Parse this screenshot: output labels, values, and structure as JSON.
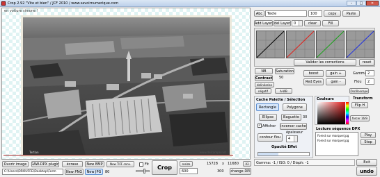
{
  "titlebar": {
    "title": "Crop 2.92  \"Vite et bien\"  / JCF 2010 / www.savoirnumerique.com"
  },
  "canvas": {
    "caption": "en voiture simone !"
  },
  "photo": {
    "credit_left": "Tertian",
    "credit_right": "www.delcampe.net"
  },
  "text_tool": {
    "abc_label": "Abc",
    "text_value": "Texte",
    "size_value": "100",
    "copy_label": "copy",
    "paste_label": "Paste"
  },
  "layers": {
    "add_label": "Add Layer",
    "del_label": "del Layer",
    "layer_value": "0",
    "clear_label": "clear",
    "fill_label": "Fill"
  },
  "curves": {
    "validate_label": "Valider les corrections",
    "reset_label": "reset"
  },
  "adjust": {
    "nb_label": "NB",
    "saturation_label": "Saturation",
    "contrast_label": "Contrast",
    "contrast_value": "50",
    "delinear_label": "delinéarise",
    "negatif_label": "négatif",
    "awb_label": "A-WB",
    "boost_label": "boost",
    "gain_plus_label": "gain +",
    "gamma_label": "Gamma",
    "gamma_value": "2",
    "red_eyes_label": "Red Eyes",
    "gain_minus_label": "gain -",
    "flou_label": "Flou",
    "flou_value": "2",
    "oscilloscope_label": "Oscilloscope"
  },
  "cache": {
    "title": "Cache Palette / Sélection",
    "rectangle_label": "Rectangle",
    "polygone_label": "Polygone",
    "ellipse_label": "Ellipse",
    "baguette_label": "Baguette",
    "baguette_value": "30",
    "afficher_label": "Afficher",
    "inverser_label": "inverser cache",
    "contour_label": "contour flou",
    "epaisseur_label": "épaisseur",
    "epaisseur_value": "4",
    "opacite_label": "Opacité Effet"
  },
  "couleurs": {
    "title": "Couleurs"
  },
  "transform": {
    "title": "Transform",
    "flip_label": "Flip H",
    "forcer_label": "forcer 16/9"
  },
  "sequence": {
    "title": "Lecture séquence DPX",
    "items": [
      "Forest sur marquer.jpg",
      "Forest sur marquer.jpg"
    ],
    "play_label": "Play",
    "stop_label": "Stop"
  },
  "status": {
    "text": "Gamma: -1 / ISO: 0 / Diaph: -1",
    "exit_label": "Exit",
    "undo_label": "undo"
  },
  "bottom": {
    "open_label": "Ouvrir image",
    "raw_label": "RAW-DPX plugin",
    "ecrase_label": "écrase",
    "new_bmp_label": "New BMP",
    "new_tiff_label": "New TIFF conv.",
    "fit_label": "Fit",
    "crop_label": "Crop",
    "resize_label": "resize",
    "resize_value": "600",
    "width_value": "15728",
    "x_label": "x",
    "height_value": "11680",
    "x2_label": "X2",
    "height2_value": "300",
    "path_value": "C:\\Users\\DROUFFE\\Desktop\\Ferm",
    "new_png_label": "New PNG",
    "new_jpg_label": "New JPG",
    "jpg_quality": "80",
    "change_dpi_label": "change DPI"
  },
  "colors": {
    "titlebar_a": "#c9dbf1",
    "titlebar_b": "#b4cae6",
    "photo_border": "#e9e6d8",
    "crop_line": "#9c1a1a"
  }
}
